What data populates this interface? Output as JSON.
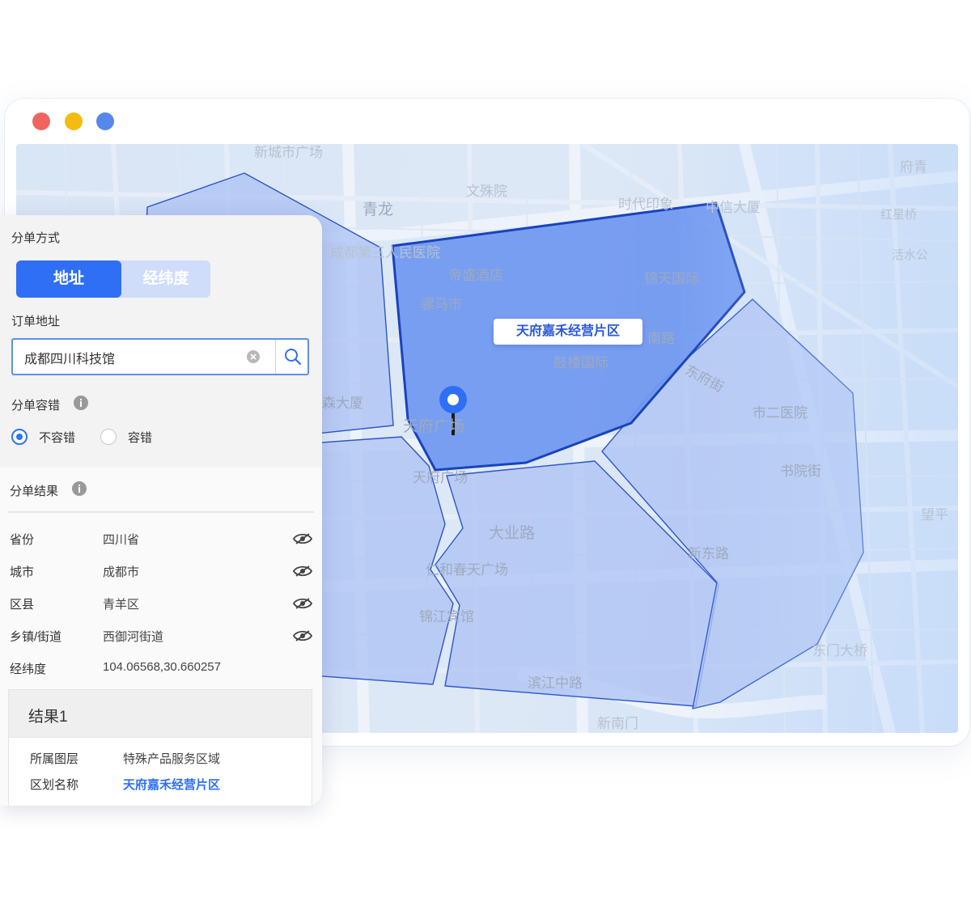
{
  "window": {
    "controls": [
      {
        "name": "close",
        "color": "#f0645e"
      },
      {
        "name": "minimize",
        "color": "#f5bb10"
      },
      {
        "name": "maximize",
        "color": "#5588ea"
      }
    ]
  },
  "map": {
    "selected_zone_label": "天府嘉禾经营片区",
    "streets": [
      "新城市广场",
      "文殊院",
      "青龙",
      "时代印象",
      "中信大厦",
      "府青",
      "红星桥",
      "活水公",
      "成都第三人民医院",
      "帝盛酒店",
      "锦天国际",
      "骡马市",
      "南路",
      "鼓楼国际",
      "东府街",
      "森大厦",
      "天府广场",
      "市二医院",
      "天府广场",
      "书院街",
      "大业路",
      "望平",
      "仁和春天广场",
      "新东路",
      "锦江宾馆",
      "东门大桥",
      "滨江中路",
      "新南门"
    ]
  },
  "panel": {
    "split_mode_label": "分单方式",
    "tabs": [
      "地址",
      "经纬度"
    ],
    "order_address_label": "订单地址",
    "address_value": "成都四川科技馆",
    "tolerance_label": "分单容错",
    "radio_options": [
      "不容错",
      "容错"
    ],
    "result_label": "分单结果",
    "rows": [
      {
        "key": "省份",
        "value": "四川省"
      },
      {
        "key": "城市",
        "value": "成都市"
      },
      {
        "key": "区县",
        "value": "青羊区"
      },
      {
        "key": "乡镇/街道",
        "value": "西御河街道"
      },
      {
        "key": "经纬度",
        "value": "104.06568,30.660257"
      }
    ],
    "card": {
      "title": "结果1",
      "layer_key": "所属图层",
      "layer_value": "特殊产品服务区域",
      "region_key": "区划名称",
      "region_value": "天府嘉禾经营片区"
    }
  },
  "colors": {
    "primary": "#2f6ff6",
    "zone_selected_fill": "#6f97f0",
    "zone_fill": "#aec3f3",
    "zone_stroke": "#1f49c4"
  }
}
